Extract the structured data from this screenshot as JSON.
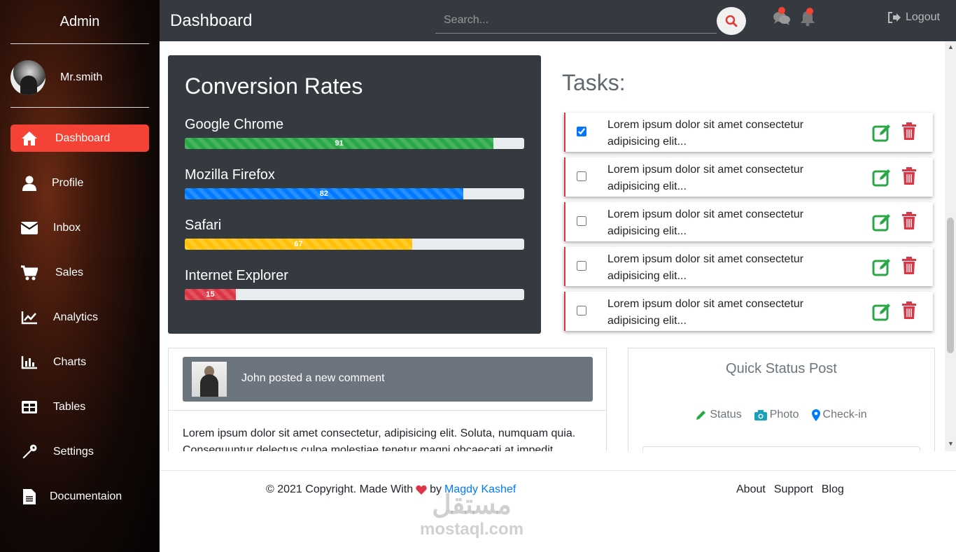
{
  "sidebar": {
    "title": "Admin",
    "user_name": "Mr.smith",
    "items": [
      {
        "label": "Dashboard",
        "icon": "home-icon",
        "active": true
      },
      {
        "label": "Profile",
        "icon": "user-icon"
      },
      {
        "label": "Inbox",
        "icon": "envelope-icon"
      },
      {
        "label": "Sales",
        "icon": "cart-icon"
      },
      {
        "label": "Analytics",
        "icon": "line-chart-icon"
      },
      {
        "label": "Charts",
        "icon": "bar-chart-icon"
      },
      {
        "label": "Tables",
        "icon": "table-icon"
      },
      {
        "label": "Settings",
        "icon": "wrench-icon"
      },
      {
        "label": "Documentaion",
        "icon": "document-icon"
      }
    ]
  },
  "header": {
    "title": "Dashboard",
    "search_placeholder": "Search...",
    "logout_label": "Logout"
  },
  "conversion": {
    "title": "Conversion Rates",
    "bars": [
      {
        "label": "Google Chrome",
        "value": 91,
        "color": "#28a745"
      },
      {
        "label": "Mozilla Firefox",
        "value": 82,
        "color": "#007bff"
      },
      {
        "label": "Safari",
        "value": 67,
        "color": "#ffc107"
      },
      {
        "label": "Internet Explorer",
        "value": 15,
        "color": "#dc3545"
      }
    ]
  },
  "tasks": {
    "title": "Tasks:",
    "items": [
      {
        "text": "Lorem ipsum dolor sit amet consectetur adipisicing elit...",
        "checked": true
      },
      {
        "text": "Lorem ipsum dolor sit amet consectetur adipisicing elit...",
        "checked": false
      },
      {
        "text": "Lorem ipsum dolor sit amet consectetur adipisicing elit...",
        "checked": false
      },
      {
        "text": "Lorem ipsum dolor sit amet consectetur adipisicing elit...",
        "checked": false
      },
      {
        "text": "Lorem ipsum dolor sit amet consectetur adipisicing elit...",
        "checked": false
      }
    ]
  },
  "comment": {
    "title": "John posted a new comment",
    "body": "Lorem ipsum dolor sit amet consectetur, adipisicing elit. Soluta, numquam quia. Consequuntur delectus culpa molestiae tenetur magni obcaecati at impedit"
  },
  "quick_status": {
    "title": "Quick Status Post",
    "options": [
      {
        "label": "Status",
        "icon": "pencil-icon",
        "color": "#28a745"
      },
      {
        "label": "Photo",
        "icon": "camera-icon",
        "color": "#17a2b8"
      },
      {
        "label": "Check-in",
        "icon": "map-marker-icon",
        "color": "#007bff"
      }
    ]
  },
  "footer": {
    "copyright_prefix": "© 2021 Copyright. Made With",
    "by": "by",
    "author": "Magdy Kashef",
    "links": [
      "About",
      "Support",
      "Blog"
    ]
  },
  "watermark": {
    "arabic": "مستقل",
    "english": "mostaql.com"
  }
}
